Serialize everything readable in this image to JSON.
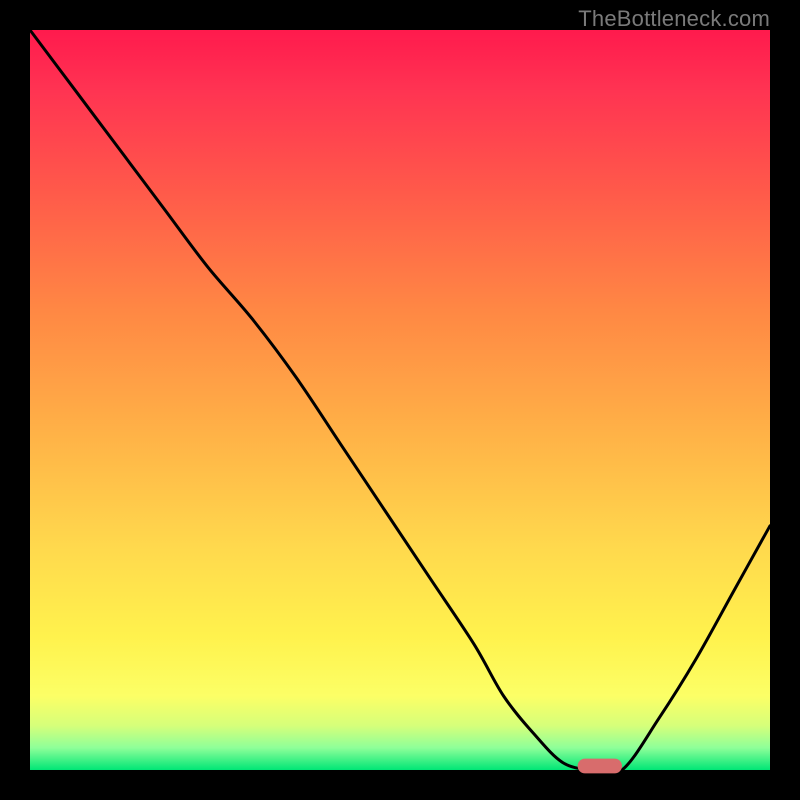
{
  "watermark": "TheBottleneck.com",
  "chart_data": {
    "type": "line",
    "title": "",
    "xlabel": "",
    "ylabel": "",
    "xlim": [
      0,
      100
    ],
    "ylim": [
      0,
      100
    ],
    "grid": false,
    "legend": false,
    "background_gradient": {
      "top_color": "#ff1a4d",
      "mid_color": "#ffd94d",
      "bottom_color": "#00e676"
    },
    "series": [
      {
        "name": "bottleneck-curve",
        "color": "#000000",
        "x": [
          0,
          6,
          12,
          18,
          24,
          30,
          36,
          42,
          48,
          54,
          60,
          64,
          68,
          72,
          76,
          80,
          85,
          90,
          95,
          100
        ],
        "y": [
          100,
          92,
          84,
          76,
          68,
          61,
          53,
          44,
          35,
          26,
          17,
          10,
          5,
          1,
          0,
          0,
          7,
          15,
          24,
          33
        ]
      }
    ],
    "marker": {
      "name": "optimal-range",
      "shape": "capsule",
      "color": "#d86c6c",
      "x_center": 77,
      "y": 0,
      "width": 6,
      "height": 2
    }
  }
}
